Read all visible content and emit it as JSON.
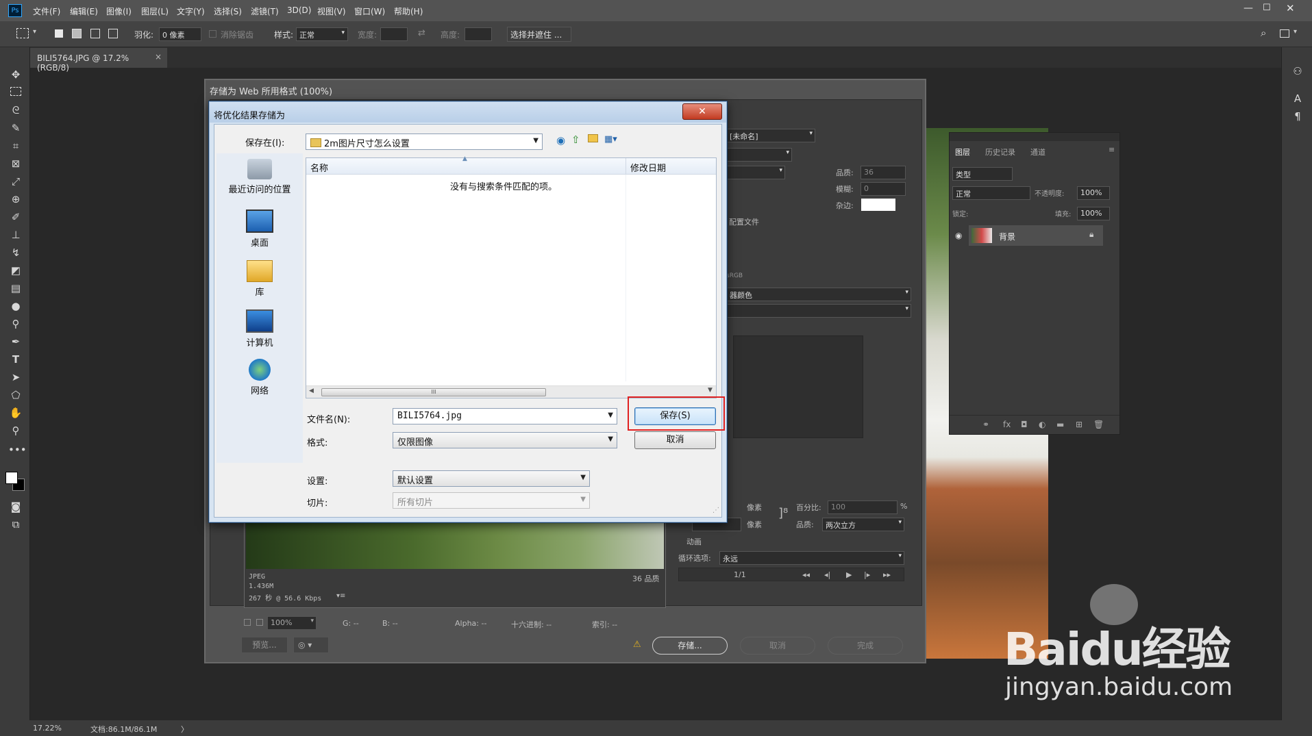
{
  "menubar": {
    "logo": "Ps",
    "items": [
      "文件(F)",
      "编辑(E)",
      "图像(I)",
      "图层(L)",
      "文字(Y)",
      "选择(S)",
      "滤镜(T)",
      "3D(D)",
      "视图(V)",
      "窗口(W)",
      "帮助(H)"
    ]
  },
  "options": {
    "feather_label": "羽化:",
    "feather_value": "0 像素",
    "antialias_label": "消除锯齿",
    "style_label": "样式:",
    "style_value": "正常",
    "width_label": "宽度:",
    "height_label": "高度:",
    "select_mask": "选择并遮住 ..."
  },
  "doc_tab": {
    "label": "BILI5764.JPG @ 17.2%(RGB/8)",
    "close": "×"
  },
  "status": {
    "zoom": "17.22%",
    "doc": "文档:86.1M/86.1M",
    "arrow": "〉"
  },
  "layers_panel": {
    "tabs": [
      "图层",
      "历史记录",
      "通道"
    ],
    "search": "类型",
    "blend": "正常",
    "opacity_label": "不透明度:",
    "opacity": "100%",
    "lock_label": "锁定:",
    "fill_label": "填充:",
    "fill": "100%",
    "layer_name": "背景"
  },
  "sfw": {
    "title": "存储为 Web 所用格式 (100%)",
    "preset_unnamed": "[未命名]",
    "quality_label": "品质:",
    "quality_value": "36",
    "blur_label": "模糊:",
    "blur_value": "0",
    "matte_label": "杂边:",
    "profile_text": "配置文件",
    "srgb_text": "sRGB",
    "color_text": "器颜色",
    "img_info": [
      "JPEG",
      "1.436M",
      "267 秒 @ 56.6 Kbps"
    ],
    "img_quality": "36 品质",
    "px_label": "像素",
    "px_label2": "像素",
    "percent_label": "百分比:",
    "percent_value": "100",
    "percent_unit": "%",
    "resample_label": "品质:",
    "resample_value": "两次立方",
    "anim_label": "动画",
    "loop_label": "循环选项:",
    "loop_value": "永远",
    "frame": "1/1",
    "bottom_bar": {
      "zoom": "100%",
      "g": "G: --",
      "b": "B: --",
      "alpha": "Alpha: --",
      "hex": "十六进制: --",
      "index": "索引: --"
    },
    "preview_btn": "预览...",
    "save_btn": "存储...",
    "cancel_btn": "取消",
    "done_btn": "完成"
  },
  "dialog": {
    "title": "将优化结果存储为",
    "close": "✕",
    "save_in_label": "保存在(I):",
    "save_in_value": "2m图片尺寸怎么设置",
    "places": [
      "最近访问的位置",
      "桌面",
      "库",
      "计算机",
      "网络"
    ],
    "col_name": "名称",
    "col_date": "修改日期",
    "empty": "没有与搜索条件匹配的项。",
    "filename_label": "文件名(N):",
    "filename_value": "BILI5764.jpg",
    "format_label": "格式:",
    "format_value": "仅限图像",
    "settings_label": "设置:",
    "settings_value": "默认设置",
    "slices_label": "切片:",
    "slices_value": "所有切片",
    "save_btn": "保存(S)",
    "cancel_btn": "取消",
    "scroll_grip": "III"
  },
  "watermark": {
    "brand": "Baidu经验",
    "url": "jingyan.baidu.com"
  },
  "colors": {
    "highlight": "#e02020",
    "dialog_blue": "#1b3f68",
    "ps_bg": "#282828"
  }
}
